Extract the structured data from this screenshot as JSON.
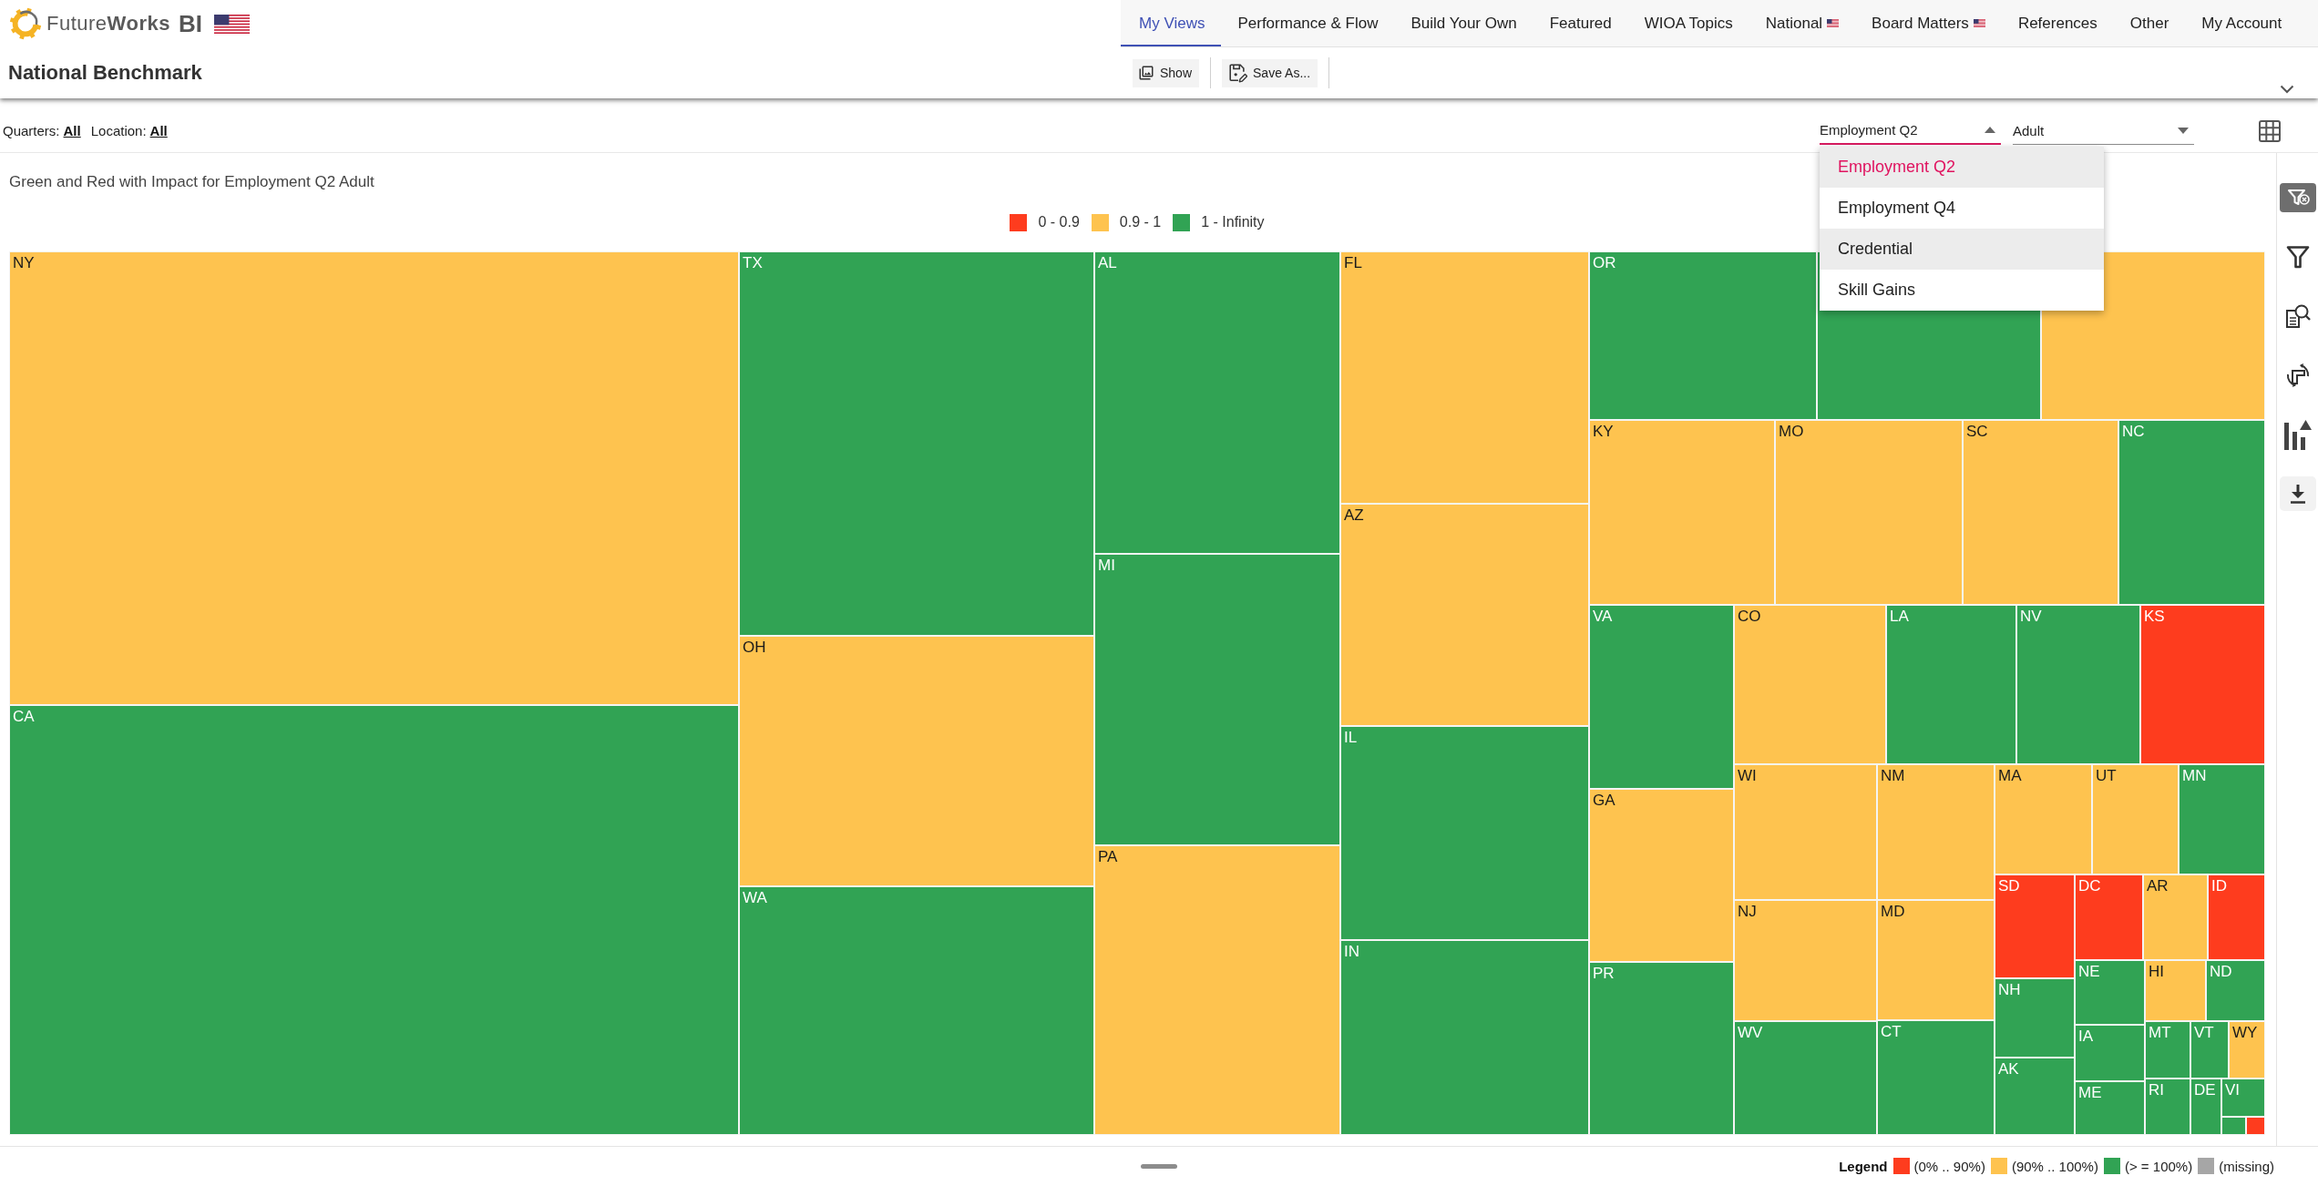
{
  "header": {
    "brand": "Future**Works**",
    "brand_suffix": "BI",
    "page_title": "National Benchmark"
  },
  "nav_tabs": [
    {
      "label": "My Views",
      "selected": true,
      "flag": false
    },
    {
      "label": "Performance & Flow",
      "selected": false,
      "flag": false
    },
    {
      "label": "Build Your Own",
      "selected": false,
      "flag": false
    },
    {
      "label": "Featured",
      "selected": false,
      "flag": false
    },
    {
      "label": "WIOA Topics",
      "selected": false,
      "flag": false
    },
    {
      "label": "National",
      "selected": false,
      "flag": true
    },
    {
      "label": "Board Matters",
      "selected": false,
      "flag": true
    },
    {
      "label": "References",
      "selected": false,
      "flag": false
    },
    {
      "label": "Other",
      "selected": false,
      "flag": false
    },
    {
      "label": "My Account",
      "selected": false,
      "flag": false
    }
  ],
  "toolbar": [
    {
      "kind": "show",
      "label": "Show"
    },
    {
      "kind": "save",
      "label": "Save As..."
    }
  ],
  "filters": [
    {
      "label": "Quarters:",
      "value": "All"
    },
    {
      "label": "Location:",
      "value": "All"
    }
  ],
  "selects": [
    {
      "value": "Employment Q2",
      "expanded": true,
      "options": [
        {
          "label": "Employment Q2",
          "selected": true,
          "highlighted": false
        },
        {
          "label": "Employment Q4",
          "selected": false,
          "highlighted": false
        },
        {
          "label": "Credential",
          "selected": false,
          "highlighted": true
        },
        {
          "label": "Skill Gains",
          "selected": false,
          "highlighted": false
        }
      ]
    },
    {
      "value": "Adult",
      "expanded": false
    }
  ],
  "chart": {
    "title": "Green and Red with Impact for Employment Q2 Adult",
    "legend": [
      {
        "label": "0 - 0.9",
        "color": "#fe3c1e"
      },
      {
        "label": "0.9 - 1",
        "color": "#fec34f"
      },
      {
        "label": "1 - Infinity",
        "color": "#31a354"
      }
    ],
    "cells": [
      {
        "label": "NY",
        "color": "#fec34f"
      },
      {
        "label": "CA",
        "color": "#31a354"
      },
      {
        "label": "TX",
        "color": "#31a354"
      },
      {
        "label": "OH",
        "color": "#fec34f"
      },
      {
        "label": "WA",
        "color": "#31a354"
      },
      {
        "label": "AL",
        "color": "#31a354"
      },
      {
        "label": "MI",
        "color": "#31a354"
      },
      {
        "label": "PA",
        "color": "#fec34f"
      },
      {
        "label": "FL",
        "color": "#fec34f"
      },
      {
        "label": "AZ",
        "color": "#fec34f"
      },
      {
        "label": "IL",
        "color": "#31a354"
      },
      {
        "label": "IN",
        "color": "#31a354"
      },
      {
        "label": "OR",
        "color": "#31a354"
      },
      {
        "color": "#31a354"
      },
      {
        "color": "#fec34f"
      },
      {
        "label": "KY",
        "color": "#fec34f"
      },
      {
        "label": "MO",
        "color": "#fec34f"
      },
      {
        "label": "SC",
        "color": "#fec34f"
      },
      {
        "label": "NC",
        "color": "#31a354"
      },
      {
        "label": "VA",
        "color": "#31a354"
      },
      {
        "label": "GA",
        "color": "#fec34f"
      },
      {
        "label": "PR",
        "color": "#31a354"
      },
      {
        "label": "CO",
        "color": "#fec34f"
      },
      {
        "label": "LA",
        "color": "#31a354"
      },
      {
        "label": "NV",
        "color": "#31a354"
      },
      {
        "label": "KS",
        "color": "#fe3c1e"
      },
      {
        "label": "WI",
        "color": "#fec34f"
      },
      {
        "label": "NJ",
        "color": "#fec34f"
      },
      {
        "label": "WV",
        "color": "#31a354"
      },
      {
        "label": "NM",
        "color": "#fec34f"
      },
      {
        "label": "MD",
        "color": "#fec34f"
      },
      {
        "label": "CT",
        "color": "#31a354"
      },
      {
        "label": "MA",
        "color": "#fec34f"
      },
      {
        "label": "UT",
        "color": "#fec34f"
      },
      {
        "label": "MN",
        "color": "#31a354"
      },
      {
        "label": "SD",
        "color": "#fe3c1e"
      },
      {
        "label": "DC",
        "color": "#fe3c1e"
      },
      {
        "label": "AR",
        "color": "#fec34f"
      },
      {
        "label": "ID",
        "color": "#fe3c1e"
      },
      {
        "label": "NH",
        "color": "#31a354"
      },
      {
        "label": "AK",
        "color": "#31a354"
      },
      {
        "label": "NE",
        "color": "#31a354"
      },
      {
        "label": "IA",
        "color": "#31a354"
      },
      {
        "label": "ME",
        "color": "#31a354"
      },
      {
        "label": "HI",
        "color": "#fec34f"
      },
      {
        "label": "ND",
        "color": "#31a354"
      },
      {
        "label": "MT",
        "color": "#31a354"
      },
      {
        "label": "VT",
        "color": "#31a354"
      },
      {
        "label": "WY",
        "color": "#fec34f"
      },
      {
        "label": "RI",
        "color": "#31a354"
      },
      {
        "label": "DE",
        "color": "#31a354"
      },
      {
        "label": "VI",
        "color": "#31a354"
      },
      {
        "color": "#31a354"
      },
      {
        "color": "#fe3c1e"
      }
    ]
  },
  "footer_legend": {
    "title": "Legend",
    "items": [
      {
        "label": "(0% .. 90%)",
        "color": "#fe3c1e"
      },
      {
        "label": "(90% .. 100%)",
        "color": "#fec34f"
      },
      {
        "label": "(> = 100%)",
        "color": "#31a354"
      },
      {
        "label": "(missing)",
        "color": "#a6a6a6"
      }
    ]
  }
}
